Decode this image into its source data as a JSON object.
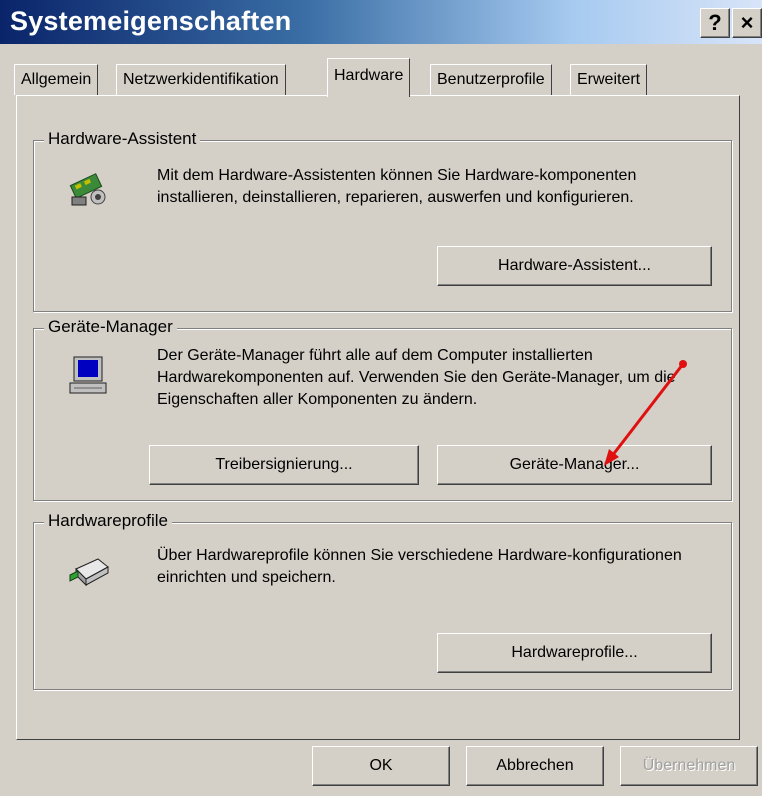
{
  "window": {
    "title": "Systemeigenschaften"
  },
  "titlebar_buttons": {
    "help": "?",
    "close": "×"
  },
  "tabs": [
    {
      "label": "Allgemein"
    },
    {
      "label": "Netzwerkidentifikation"
    },
    {
      "label": "Hardware"
    },
    {
      "label": "Benutzerprofile"
    },
    {
      "label": "Erweitert"
    }
  ],
  "hardware_wizard": {
    "group_title": "Hardware-Assistent",
    "text": "Mit dem Hardware-Assistenten können Sie Hardware-komponenten installieren, deinstallieren, reparieren, auswerfen und konfigurieren.",
    "button": "Hardware-Assistent..."
  },
  "device_manager": {
    "group_title": "Geräte-Manager",
    "text": "Der Geräte-Manager führt alle auf dem Computer installierten Hardwarekomponenten auf. Verwenden Sie den Geräte-Manager, um die Eigenschaften aller Komponenten zu ändern.",
    "signing_button": "Treibersignierung...",
    "button": "Geräte-Manager..."
  },
  "hardware_profiles": {
    "group_title": "Hardwareprofile",
    "text": "Über Hardwareprofile können Sie verschiedene Hardware-konfigurationen einrichten und speichern.",
    "button": "Hardwareprofile..."
  },
  "dialog_buttons": {
    "ok": "OK",
    "cancel": "Abbrechen",
    "apply": "Übernehmen"
  },
  "colors": {
    "annotation_arrow": "#e01010",
    "titlebar_start": "#0a246a"
  }
}
